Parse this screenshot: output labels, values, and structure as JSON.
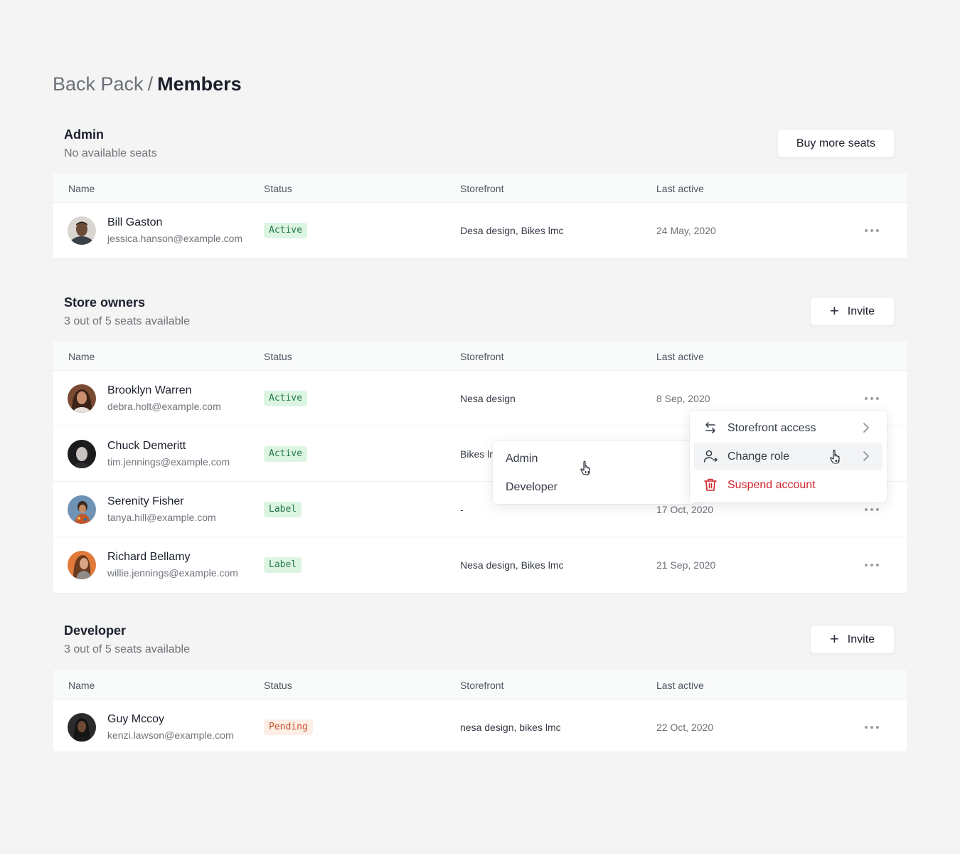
{
  "breadcrumb": {
    "parent": "Back Pack",
    "separator": "/",
    "current": "Members"
  },
  "columns": {
    "name": "Name",
    "status": "Status",
    "storefront": "Storefront",
    "last_active": "Last active"
  },
  "sections": {
    "admin": {
      "title": "Admin",
      "subtitle": "No available seats",
      "button": "Buy more seats",
      "rows": [
        {
          "name": "Bill Gaston",
          "email": "jessica.hanson@example.com",
          "status": "Active",
          "storefront": "Desa design, Bikes lmc",
          "last_active": "24 May, 2020"
        }
      ]
    },
    "store_owners": {
      "title": "Store owners",
      "subtitle": "3 out of 5 seats available",
      "button": "Invite",
      "rows": [
        {
          "name": "Brooklyn Warren",
          "email": "debra.holt@example.com",
          "status": "Active",
          "storefront": "Nesa design",
          "last_active": "8 Sep, 2020"
        },
        {
          "name": "Chuck Demeritt",
          "email": "tim.jennings@example.com",
          "status": "Active",
          "storefront": "Bikes lr",
          "last_active": ""
        },
        {
          "name": "Serenity Fisher",
          "email": "tanya.hill@example.com",
          "status": "Label",
          "storefront": "-",
          "last_active": "17 Oct, 2020"
        },
        {
          "name": "Richard Bellamy",
          "email": "willie.jennings@example.com",
          "status": "Label",
          "storefront": "Nesa design, Bikes lmc",
          "last_active": "21 Sep, 2020"
        }
      ]
    },
    "developer": {
      "title": "Developer",
      "subtitle": "3 out of 5 seats available",
      "button": "Invite",
      "rows": [
        {
          "name": "Guy Mccoy",
          "email": "kenzi.lawson@example.com",
          "status": "Pending",
          "storefront": "nesa design, bikes lmc",
          "last_active": "22 Oct, 2020"
        }
      ]
    }
  },
  "context_menu": {
    "items": [
      {
        "label": "Storefront access",
        "icon": "arrows-swap-icon"
      },
      {
        "label": "Change role",
        "icon": "user-switch-icon"
      },
      {
        "label": "Suspend account",
        "icon": "trash-icon"
      }
    ]
  },
  "role_submenu": {
    "items": [
      "Admin",
      "Developer"
    ]
  },
  "colors": {
    "background": "#f3f4f3",
    "active_badge": "#dcf5e3",
    "pending_badge": "#fdeee6",
    "danger": "#d1222b"
  }
}
